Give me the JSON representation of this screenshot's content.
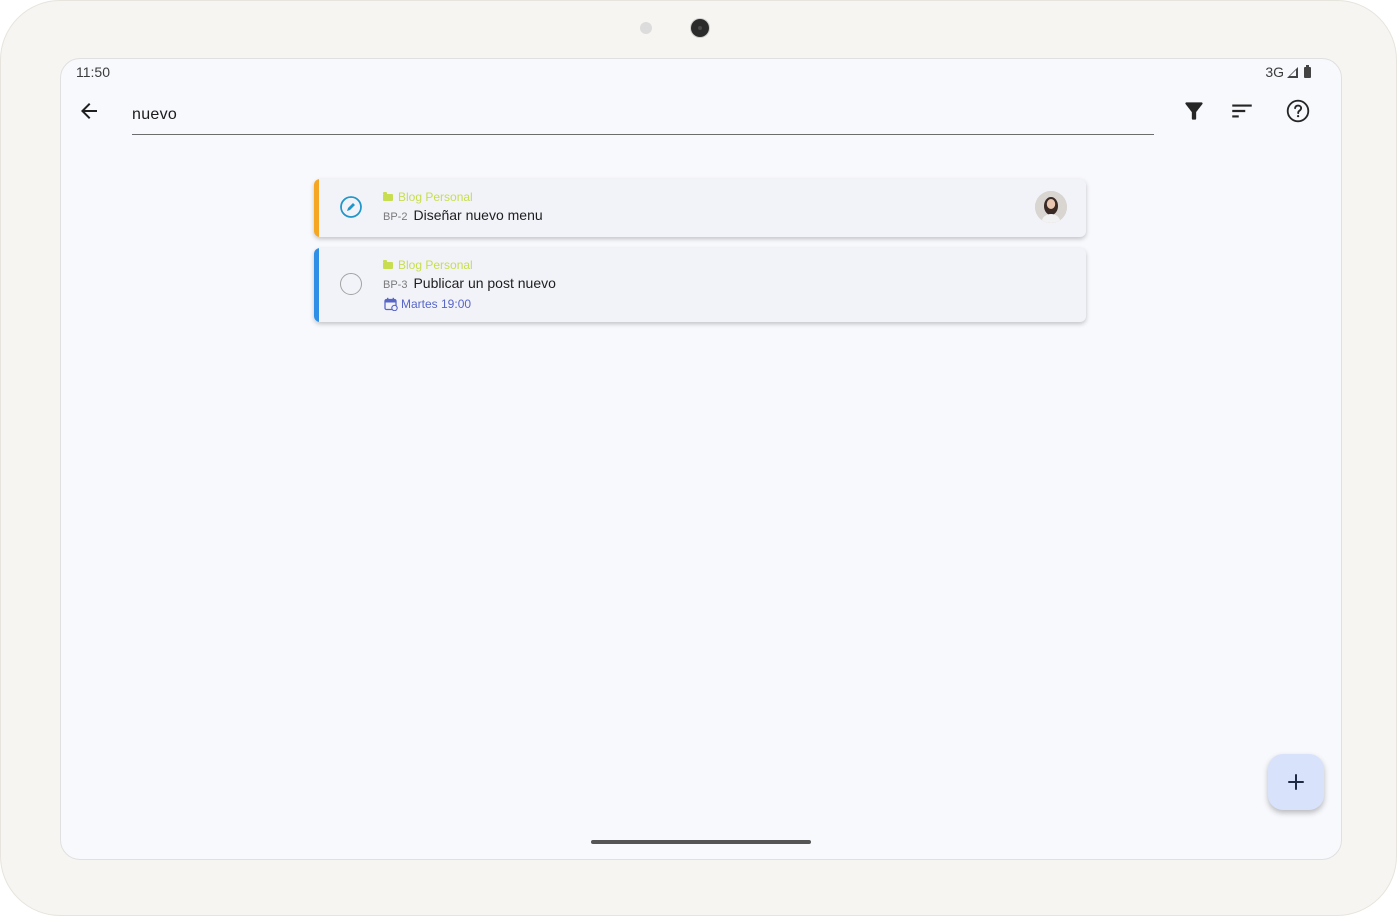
{
  "status_bar": {
    "time": "11:50",
    "network": "3G",
    "icons": [
      "signal-icon",
      "battery-icon"
    ]
  },
  "search": {
    "value": "nuevo",
    "back_icon": "arrow-back-icon",
    "actions": [
      "filter-icon",
      "sort-icon",
      "help-icon"
    ]
  },
  "tasks": [
    {
      "project": "Blog Personal",
      "key": "BP-2",
      "title": "Diseñar nuevo menu",
      "status": "in-progress",
      "accent_color": "#f5a623",
      "has_avatar": true
    },
    {
      "project": "Blog Personal",
      "key": "BP-3",
      "title": "Publicar un post nuevo",
      "status": "todo",
      "accent_color": "#2f8fe6",
      "due": "Martes 19:00"
    }
  ],
  "fab": {
    "icon": "plus-icon"
  },
  "colors": {
    "project_label": "#c8dd4f",
    "due_date": "#5866c8",
    "in_progress_check": "#2196c8",
    "fab_background": "#d8e2fb"
  }
}
